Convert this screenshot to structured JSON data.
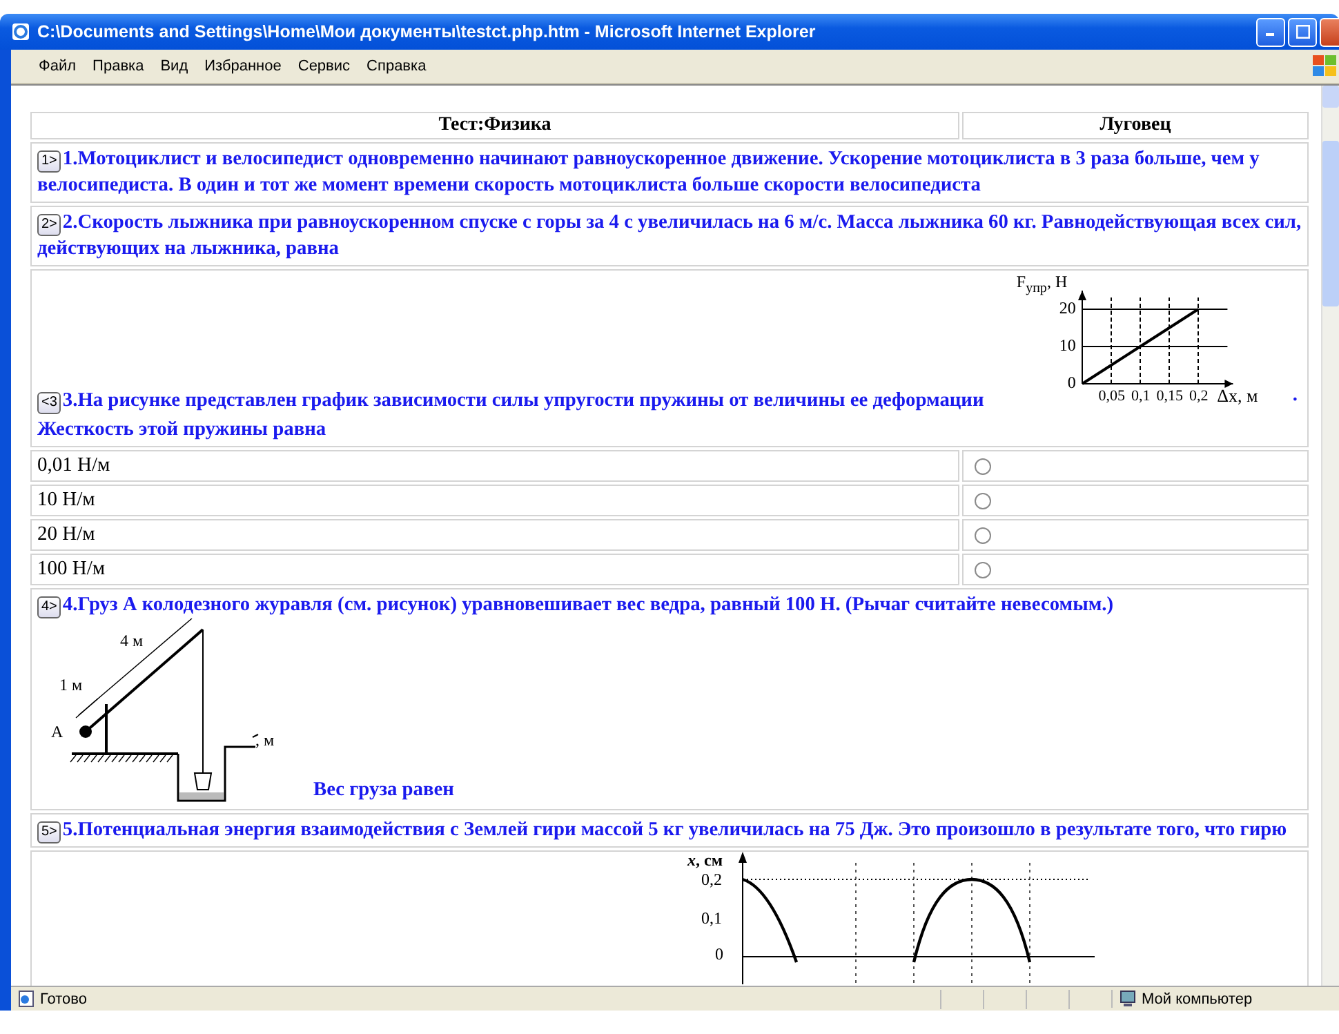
{
  "window": {
    "title": "C:\\Documents and Settings\\Home\\Мои документы\\testct.php.htm - Microsoft Internet Explorer"
  },
  "menu": [
    "Файл",
    "Правка",
    "Вид",
    "Избранное",
    "Сервис",
    "Справка"
  ],
  "test": {
    "header": [
      "Тест:Физика",
      "Луговец"
    ],
    "items": [
      {
        "kind": "question",
        "badge": "1>",
        "text": "1.Мотоциклист и велосипедист одновременно начинают равноускоренное движение. Ускорение мотоциклиста в 3 раза больше, чем у велосипедиста. В один и тот же момент времени скорость мотоциклиста больше скорости велосипедиста"
      },
      {
        "kind": "question",
        "badge": "2>",
        "text": "2.Скорость лыжника при равноускоренном спуске с горы за 4 с увеличилась на 6 м/с. Масса лыжника 60 кг. Равнодействующая всех сил, действующих на лыжника, равна"
      },
      {
        "kind": "chart_question",
        "badge": "<3",
        "text": "3.На рисунке представлен график зависимости силы упругости пружины от величины ее деформации",
        "tail": ".",
        "subtext": "Жесткость этой пружины равна",
        "chart_data": {
          "type": "line",
          "xlabel": "Δx, м",
          "ylabel": "F$_{упр}$, Н",
          "x": [
            0,
            0.05,
            0.1,
            0.15,
            0.2
          ],
          "series": [
            {
              "color": "#000000",
              "values": [
                0,
                5,
                10,
                15,
                20
              ]
            }
          ],
          "xlim": [
            0,
            0.26
          ],
          "ylim": [
            0,
            25
          ],
          "grid": true,
          "xticks": [
            {
              "value": 0.05,
              "label": "0,05"
            },
            {
              "value": 0.1,
              "label": "0,1"
            },
            {
              "value": 0.15,
              "label": "0,15"
            },
            {
              "value": 0.2,
              "label": "0,2"
            }
          ],
          "yticks": [
            0,
            10,
            20
          ]
        }
      },
      {
        "kind": "option",
        "label": "0,01 Н/м",
        "selected": false
      },
      {
        "kind": "option",
        "label": "10 Н/м",
        "selected": false
      },
      {
        "kind": "option",
        "label": "20 Н/м",
        "selected": false
      },
      {
        "kind": "option",
        "label": "100 Н/м",
        "selected": false
      },
      {
        "kind": "well_question",
        "badge": "4>",
        "text": "4.Груз А колодезного журавля (см. рисунок) уравновешивает вес ведра, равный 100 Н. (Рычаг считайте невесомым.)",
        "labels": [
          "4 м",
          "1 м",
          "А",
          ", м"
        ],
        "caption": "Вес груза равен"
      },
      {
        "kind": "question",
        "badge": "5>",
        "text": "5.Потенциальная энергия взаимодействия с Землей гири массой 5 кг увеличилась на 75 Дж. Это произошло в результате того, что гирю"
      },
      {
        "kind": "graph",
        "labels": [
          "*x*, см",
          "0,2",
          "0,1",
          "0"
        ]
      }
    ]
  },
  "status_bar": {
    "left": "Готово",
    "right": "Мой компьютер"
  }
}
